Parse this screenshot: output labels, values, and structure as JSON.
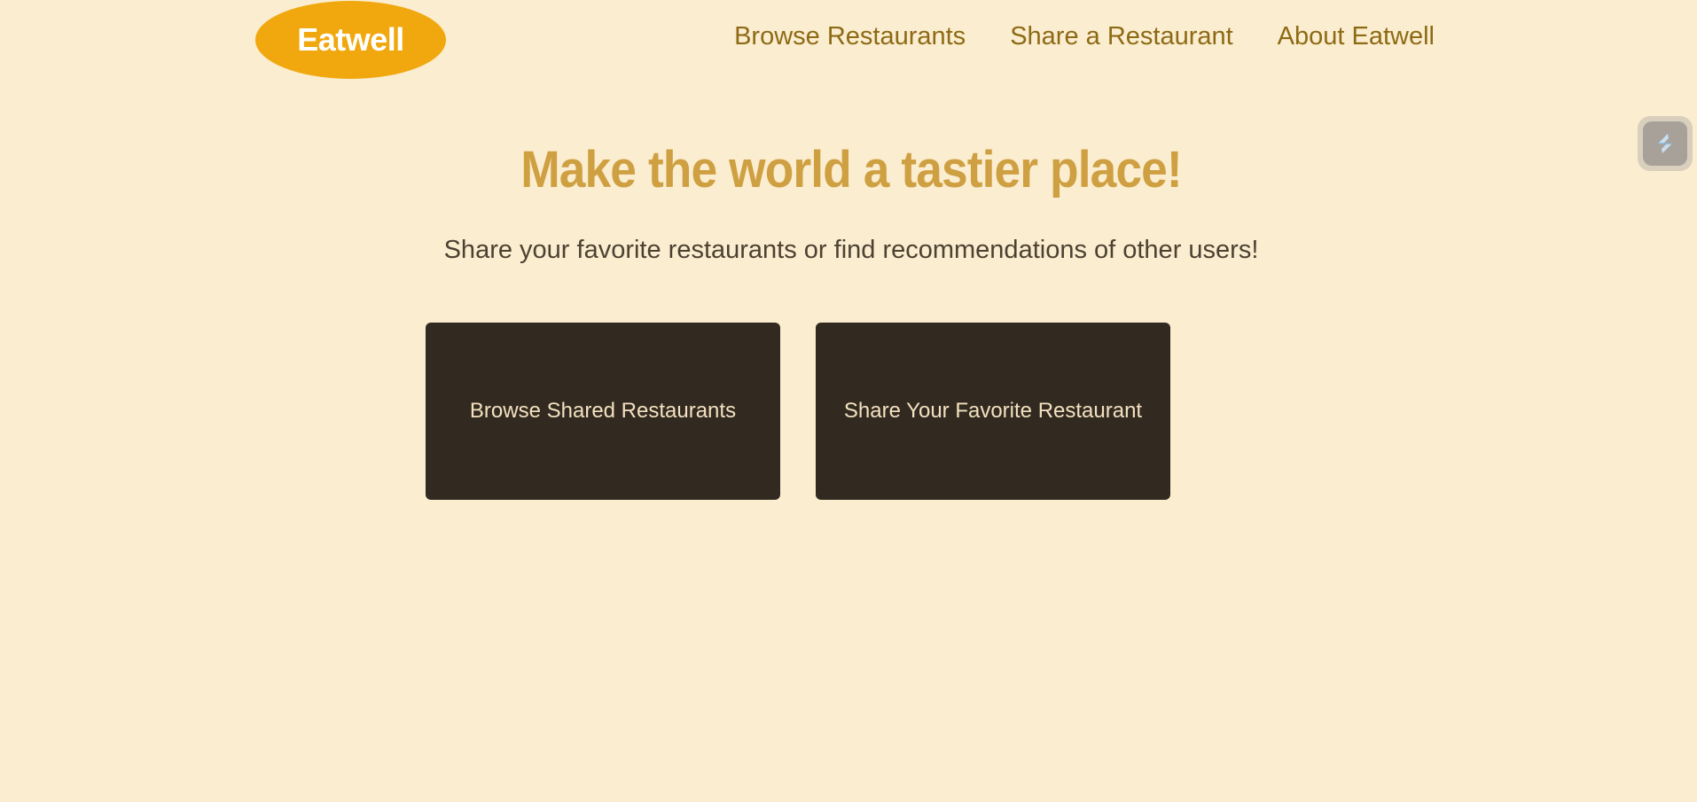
{
  "header": {
    "logo_text": "Eatwell",
    "nav": [
      {
        "label": "Browse Restaurants"
      },
      {
        "label": "Share a Restaurant"
      },
      {
        "label": "About Eatwell"
      }
    ]
  },
  "hero": {
    "title": "Make the world a tastier place!",
    "subtitle": "Share your favorite restaurants or find recommendations of other users!"
  },
  "actions": {
    "browse_label": "Browse Shared Restaurants",
    "share_label": "Share Your Favorite Restaurant"
  },
  "widget": {
    "icon": "extension-icon"
  },
  "colors": {
    "background": "#fbedd0",
    "logo": "#f0a80e",
    "nav_text": "#8d6a14",
    "title": "#cfa042",
    "button": "#322a20",
    "button_text": "#f3e1c0"
  }
}
